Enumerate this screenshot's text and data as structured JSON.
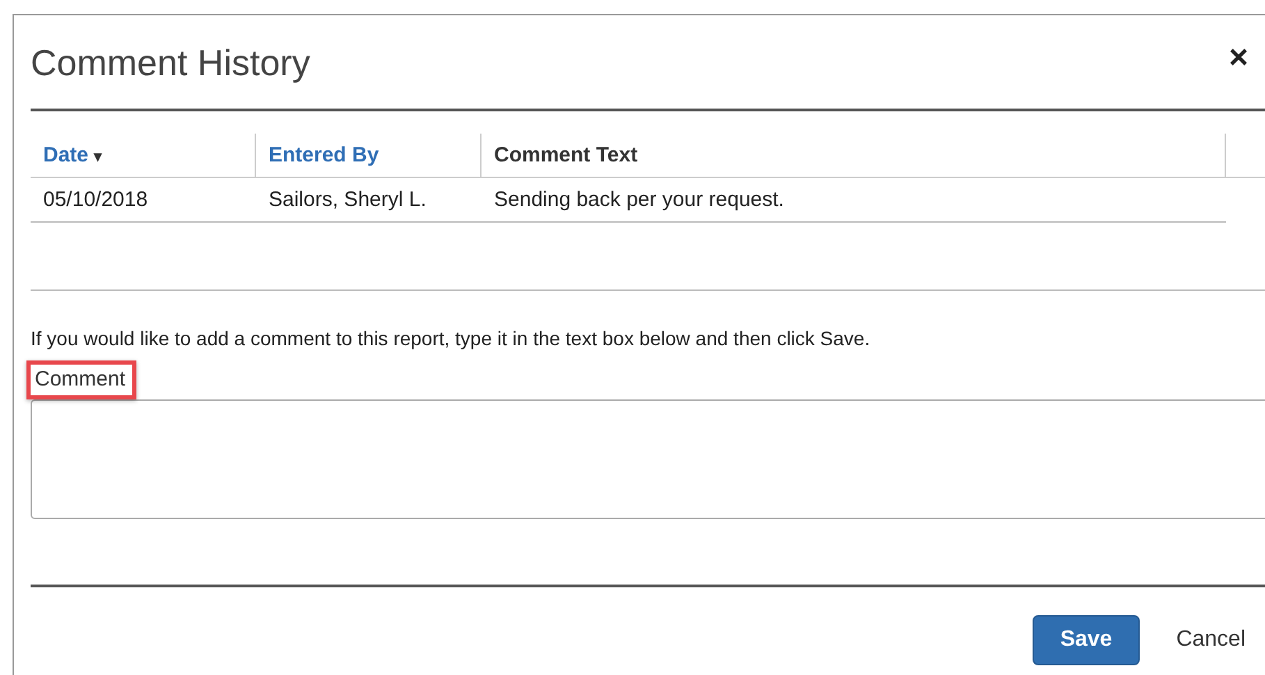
{
  "dialog": {
    "title": "Comment History",
    "close": "×"
  },
  "table": {
    "columns": [
      {
        "label": "Date",
        "sort": "▾",
        "sortable": true
      },
      {
        "label": "Entered By",
        "sortable": true
      },
      {
        "label": "Comment Text",
        "sortable": false
      }
    ],
    "rows": [
      [
        "05/10/2018",
        "Sailors, Sheryl L.",
        "Sending back per your request."
      ]
    ]
  },
  "instruction": "If you would like to add a comment to this report, type it in the text box below and then click Save.",
  "comment": {
    "label": "Comment",
    "highlighted": true
  },
  "buttons": [
    {
      "label": "Save",
      "kind": "primary"
    },
    {
      "label": "Cancel",
      "kind": "link"
    }
  ]
}
